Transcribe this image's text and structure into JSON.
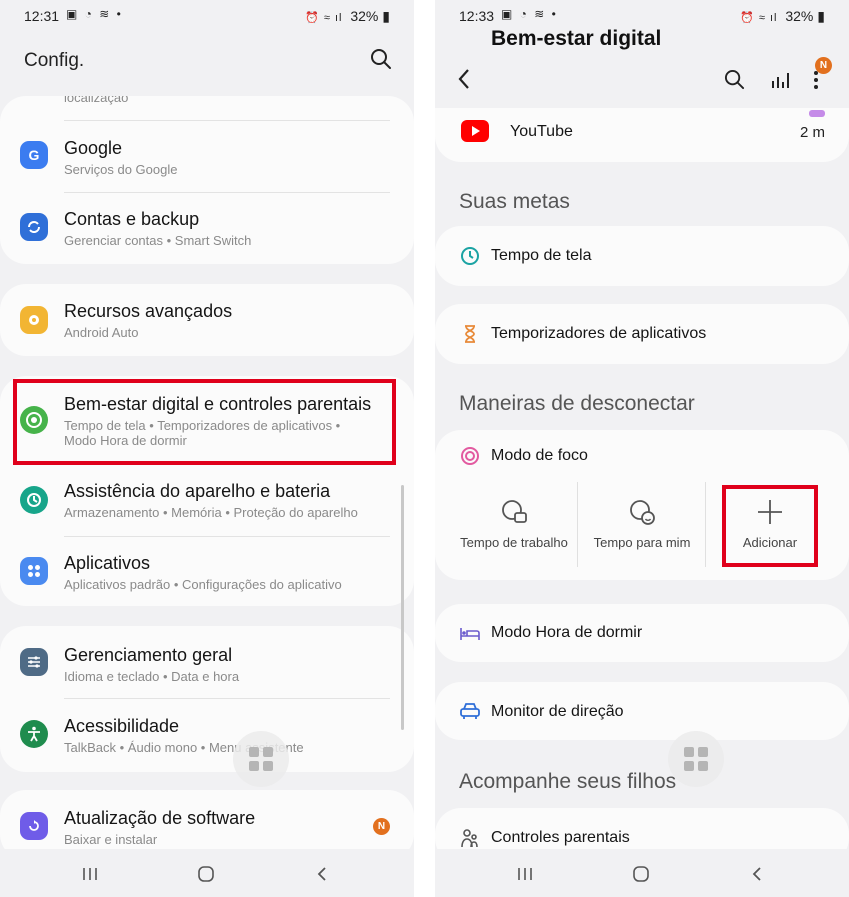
{
  "left": {
    "status": {
      "time": "12:31",
      "battery": "32%"
    },
    "header": {
      "title": "Config."
    },
    "items": [
      {
        "title": "",
        "sub": "localização"
      },
      {
        "title": "Google",
        "sub": "Serviços do Google",
        "color": "#3b7cf0"
      },
      {
        "title": "Contas e backup",
        "sub": "Gerenciar contas  •  Smart Switch",
        "color": "#2f6fd8"
      },
      {
        "title": "Recursos avançados",
        "sub": "Android Auto",
        "color": "#f2b533"
      },
      {
        "title": "Bem-estar digital e controles parentais",
        "sub": "Tempo de tela  •  Temporizadores de aplicativos  •",
        "sub2": "Modo Hora de dormir",
        "color": "#46b34a"
      },
      {
        "title": "Assistência do aparelho e bateria",
        "sub": "Armazenamento  •  Memória  •  Proteção do aparelho",
        "color": "#17a58a"
      },
      {
        "title": "Aplicativos",
        "sub": "Aplicativos padrão  •  Configurações do aplicativo",
        "color": "#4a8af0"
      },
      {
        "title": "Gerenciamento geral",
        "sub": "Idioma e teclado  •  Data e hora",
        "color": "#4f6b86"
      },
      {
        "title": "Acessibilidade",
        "sub": "TalkBack  •  Áudio mono  •  Menu assistente",
        "color": "#1f8c4e"
      },
      {
        "title": "Atualização de software",
        "sub": "Baixar e instalar",
        "color": "#6f5ce8",
        "badge": "N"
      }
    ]
  },
  "right": {
    "status": {
      "time": "12:33",
      "battery": "32%"
    },
    "header": {
      "title": "Bem-estar digital",
      "badge": "N"
    },
    "youtube": {
      "label": "YouTube",
      "time": "2 m"
    },
    "goals": {
      "heading": "Suas metas",
      "screen_time": "Tempo de tela",
      "app_timers": "Temporizadores de aplicativos"
    },
    "disconnect": {
      "heading": "Maneiras de desconectar",
      "focus_mode": "Modo de foco",
      "focus_options": [
        "Tempo de trabalho",
        "Tempo para mim",
        "Adicionar"
      ],
      "bedtime": "Modo Hora de dormir",
      "driving": "Monitor de direção"
    },
    "kids": {
      "heading": "Acompanhe seus filhos",
      "parental": "Controles parentais"
    }
  },
  "colors": {
    "highlight": "#e0001b",
    "badge": "#e2701e",
    "accent_teal": "#1ba3a3"
  }
}
